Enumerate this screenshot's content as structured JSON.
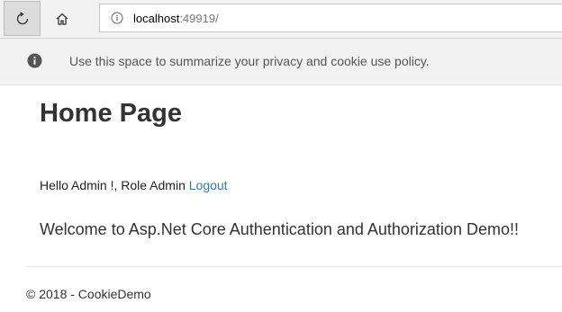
{
  "browser": {
    "refresh_icon": "refresh-icon",
    "home_icon": "home-icon",
    "info_icon": "info-icon",
    "address": {
      "host": "localhost",
      "port": ":49919/"
    }
  },
  "consent": {
    "icon": "info-circle-icon",
    "message": "Use this space to summarize your privacy and cookie use policy."
  },
  "main": {
    "title": "Home Page",
    "greeting": "Hello Admin !, Role Admin",
    "logout_label": "Logout",
    "welcome": "Welcome to Asp.Net Core Authentication and Authorization Demo!!"
  },
  "footer": {
    "text": "© 2018 - CookieDemo"
  },
  "colors": {
    "link": "#337ab7",
    "banner_bg": "#f2f2f2",
    "text": "#333333"
  }
}
